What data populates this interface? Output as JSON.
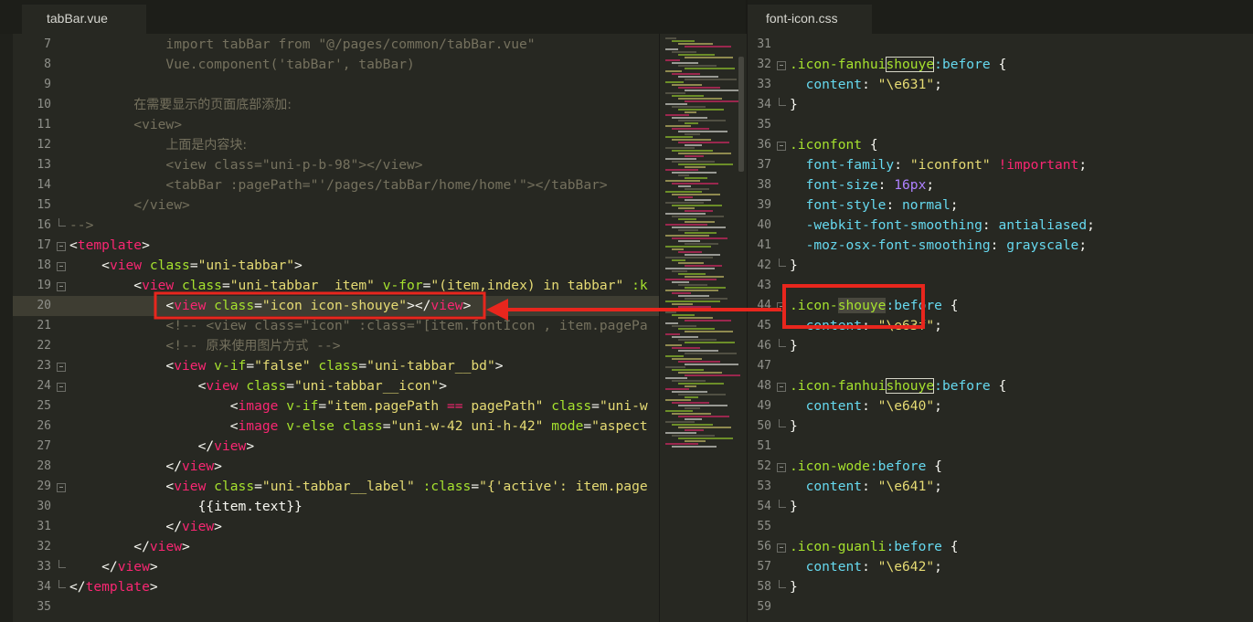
{
  "tabs": {
    "left": "tabBar.vue",
    "right": "font-icon.css"
  },
  "colors": {
    "background": "#272822",
    "annotation": "#e8261d",
    "tag": "#f92672",
    "attribute": "#a6e22e",
    "string": "#e6db74",
    "comment": "#75715e"
  },
  "left_editor": {
    "lines": [
      {
        "num": "7",
        "tokens": [
          [
            "cmt",
            "            import tabBar from \"@/pages/common/tabBar.vue\""
          ]
        ]
      },
      {
        "num": "8",
        "tokens": [
          [
            "cmt",
            "            Vue.component('tabBar', tabBar)"
          ]
        ]
      },
      {
        "num": "9",
        "tokens": [
          [
            "cmt",
            ""
          ]
        ]
      },
      {
        "num": "10",
        "tokens": [
          [
            "cmt",
            "        "
          ],
          [
            "cmt cn",
            "在需要显示的页面底部添加:"
          ]
        ]
      },
      {
        "num": "11",
        "tokens": [
          [
            "cmt",
            "        <view>"
          ]
        ]
      },
      {
        "num": "12",
        "tokens": [
          [
            "cmt",
            "            "
          ],
          [
            "cmt cn",
            "上面是内容块:"
          ]
        ]
      },
      {
        "num": "13",
        "tokens": [
          [
            "cmt",
            "            <view class=\"uni-p-b-98\"></view>"
          ]
        ]
      },
      {
        "num": "14",
        "tokens": [
          [
            "cmt",
            "            <tabBar :pagePath=\"'/pages/tabBar/home/home'\"></tabBar>"
          ]
        ]
      },
      {
        "num": "15",
        "tokens": [
          [
            "cmt",
            "        </view>"
          ]
        ]
      },
      {
        "num": "16",
        "tokens": [
          [
            "cmt",
            "-->"
          ]
        ]
      },
      {
        "num": "17",
        "tokens": [
          [
            "pln",
            "<"
          ],
          [
            "tag",
            "template"
          ],
          [
            "pln",
            ">"
          ]
        ]
      },
      {
        "num": "18",
        "tokens": [
          [
            "pln",
            "    <"
          ],
          [
            "tag",
            "view"
          ],
          [
            "att",
            " class"
          ],
          [
            "pln",
            "="
          ],
          [
            "str",
            "\"uni-tabbar\""
          ],
          [
            "pln",
            ">"
          ]
        ]
      },
      {
        "num": "19",
        "tokens": [
          [
            "pln",
            "        <"
          ],
          [
            "tag",
            "view"
          ],
          [
            "att",
            " class"
          ],
          [
            "pln",
            "="
          ],
          [
            "str",
            "\"uni-tabbar__item\""
          ],
          [
            "att",
            " v-for"
          ],
          [
            "pln",
            "="
          ],
          [
            "str",
            "\"(item,index) in tabbar\""
          ],
          [
            "att",
            " :k"
          ]
        ]
      },
      {
        "num": "20",
        "tokens": [
          [
            "pln",
            "            <"
          ],
          [
            "tag",
            "view"
          ],
          [
            "att",
            " class"
          ],
          [
            "pln",
            "="
          ],
          [
            "str",
            "\"icon icon-shouye\""
          ],
          [
            "pln",
            "></"
          ],
          [
            "tag",
            "view"
          ],
          [
            "pln",
            ">"
          ]
        ]
      },
      {
        "num": "21",
        "tokens": [
          [
            "cmt",
            "            <!-- <view class=\"icon\" :class=\"[item.fontIcon , item.pagePa"
          ]
        ]
      },
      {
        "num": "22",
        "tokens": [
          [
            "cmt",
            "            <!-- "
          ],
          [
            "cmt cn",
            "原来使用图片方式"
          ],
          [
            "cmt",
            " -->"
          ]
        ]
      },
      {
        "num": "23",
        "tokens": [
          [
            "pln",
            "            <"
          ],
          [
            "tag",
            "view"
          ],
          [
            "att",
            " v-if"
          ],
          [
            "pln",
            "="
          ],
          [
            "str",
            "\"false\""
          ],
          [
            "att",
            " class"
          ],
          [
            "pln",
            "="
          ],
          [
            "str",
            "\"uni-tabbar__bd\""
          ],
          [
            "pln",
            ">"
          ]
        ]
      },
      {
        "num": "24",
        "tokens": [
          [
            "pln",
            "                <"
          ],
          [
            "tag",
            "view"
          ],
          [
            "att",
            " class"
          ],
          [
            "pln",
            "="
          ],
          [
            "str",
            "\"uni-tabbar__icon\""
          ],
          [
            "pln",
            ">"
          ]
        ]
      },
      {
        "num": "25",
        "tokens": [
          [
            "pln",
            "                    <"
          ],
          [
            "tag",
            "image"
          ],
          [
            "att",
            " v-if"
          ],
          [
            "pln",
            "="
          ],
          [
            "str",
            "\"item.pagePath "
          ],
          [
            "tag",
            "=="
          ],
          [
            "str",
            " pagePath\""
          ],
          [
            "att",
            " class"
          ],
          [
            "pln",
            "="
          ],
          [
            "str",
            "\"uni-w"
          ]
        ]
      },
      {
        "num": "26",
        "tokens": [
          [
            "pln",
            "                    <"
          ],
          [
            "tag",
            "image"
          ],
          [
            "att",
            " v-else"
          ],
          [
            "att",
            " class"
          ],
          [
            "pln",
            "="
          ],
          [
            "str",
            "\"uni-w-42 uni-h-42\""
          ],
          [
            "att",
            " mode"
          ],
          [
            "pln",
            "="
          ],
          [
            "str",
            "\"aspect"
          ]
        ]
      },
      {
        "num": "27",
        "tokens": [
          [
            "pln",
            "                </"
          ],
          [
            "tag",
            "view"
          ],
          [
            "pln",
            ">"
          ]
        ]
      },
      {
        "num": "28",
        "tokens": [
          [
            "pln",
            "            </"
          ],
          [
            "tag",
            "view"
          ],
          [
            "pln",
            ">"
          ]
        ]
      },
      {
        "num": "29",
        "tokens": [
          [
            "pln",
            "            <"
          ],
          [
            "tag",
            "view"
          ],
          [
            "att",
            " class"
          ],
          [
            "pln",
            "="
          ],
          [
            "str",
            "\"uni-tabbar__label\""
          ],
          [
            "att",
            " :class"
          ],
          [
            "pln",
            "="
          ],
          [
            "str",
            "\"{'active': item.page"
          ]
        ]
      },
      {
        "num": "30",
        "tokens": [
          [
            "pln",
            "                {{item.text}}"
          ]
        ]
      },
      {
        "num": "31",
        "tokens": [
          [
            "pln",
            "            </"
          ],
          [
            "tag",
            "view"
          ],
          [
            "pln",
            ">"
          ]
        ]
      },
      {
        "num": "32",
        "tokens": [
          [
            "pln",
            "        </"
          ],
          [
            "tag",
            "view"
          ],
          [
            "pln",
            ">"
          ]
        ]
      },
      {
        "num": "33",
        "tokens": [
          [
            "pln",
            "    </"
          ],
          [
            "tag",
            "view"
          ],
          [
            "pln",
            ">"
          ]
        ]
      },
      {
        "num": "34",
        "tokens": [
          [
            "pln",
            "</"
          ],
          [
            "tag",
            "template"
          ],
          [
            "pln",
            ">"
          ]
        ]
      },
      {
        "num": "35",
        "tokens": [
          [
            "pln",
            ""
          ]
        ]
      }
    ]
  },
  "right_editor": {
    "lines": [
      {
        "num": "31",
        "tokens": [
          [
            "pln",
            ""
          ]
        ]
      },
      {
        "num": "32",
        "tokens": [
          [
            "cls",
            ".icon-fanhui"
          ],
          [
            "cls match",
            "shouye"
          ],
          [
            "prop",
            ":before"
          ],
          [
            "pln",
            " {"
          ]
        ]
      },
      {
        "num": "33",
        "tokens": [
          [
            "prop",
            "  content"
          ],
          [
            "pln",
            ": "
          ],
          [
            "str",
            "\"\\e631\""
          ],
          [
            "pln",
            ";"
          ]
        ]
      },
      {
        "num": "34",
        "tokens": [
          [
            "pln",
            "}"
          ]
        ]
      },
      {
        "num": "35",
        "tokens": [
          [
            "pln",
            ""
          ]
        ]
      },
      {
        "num": "36",
        "tokens": [
          [
            "cls",
            ".iconfont"
          ],
          [
            "pln",
            " {"
          ]
        ]
      },
      {
        "num": "37",
        "tokens": [
          [
            "prop",
            "  font-family"
          ],
          [
            "pln",
            ": "
          ],
          [
            "str",
            "\"iconfont\""
          ],
          [
            "tag",
            " !important"
          ],
          [
            "pln",
            ";"
          ]
        ]
      },
      {
        "num": "38",
        "tokens": [
          [
            "prop",
            "  font-size"
          ],
          [
            "pln",
            ": "
          ],
          [
            "num",
            "16px"
          ],
          [
            "pln",
            ";"
          ]
        ]
      },
      {
        "num": "39",
        "tokens": [
          [
            "prop",
            "  font-style"
          ],
          [
            "pln",
            ": "
          ],
          [
            "prop",
            "normal"
          ],
          [
            "pln",
            ";"
          ]
        ]
      },
      {
        "num": "40",
        "tokens": [
          [
            "prop",
            "  -webkit-font-smoothing"
          ],
          [
            "pln",
            ": "
          ],
          [
            "prop",
            "antialiased"
          ],
          [
            "pln",
            ";"
          ]
        ]
      },
      {
        "num": "41",
        "tokens": [
          [
            "prop",
            "  -moz-osx-font-smoothing"
          ],
          [
            "pln",
            ": "
          ],
          [
            "prop",
            "grayscale"
          ],
          [
            "pln",
            ";"
          ]
        ]
      },
      {
        "num": "42",
        "tokens": [
          [
            "pln",
            "}"
          ]
        ]
      },
      {
        "num": "43",
        "tokens": [
          [
            "pln",
            ""
          ]
        ]
      },
      {
        "num": "44",
        "tokens": [
          [
            "cls",
            ".icon-"
          ],
          [
            "cls sel",
            "shouye"
          ],
          [
            "prop",
            ":before"
          ],
          [
            "pln",
            " {"
          ]
        ]
      },
      {
        "num": "45",
        "tokens": [
          [
            "prop",
            "  content"
          ],
          [
            "pln",
            ": "
          ],
          [
            "str",
            "\"\\e63f\""
          ],
          [
            "pln",
            ";"
          ]
        ]
      },
      {
        "num": "46",
        "tokens": [
          [
            "pln",
            "}"
          ]
        ]
      },
      {
        "num": "47",
        "tokens": [
          [
            "pln",
            ""
          ]
        ]
      },
      {
        "num": "48",
        "tokens": [
          [
            "cls",
            ".icon-fanhui"
          ],
          [
            "cls match",
            "shouye"
          ],
          [
            "prop",
            ":before"
          ],
          [
            "pln",
            " {"
          ]
        ]
      },
      {
        "num": "49",
        "tokens": [
          [
            "prop",
            "  content"
          ],
          [
            "pln",
            ": "
          ],
          [
            "str",
            "\"\\e640\""
          ],
          [
            "pln",
            ";"
          ]
        ]
      },
      {
        "num": "50",
        "tokens": [
          [
            "pln",
            "}"
          ]
        ]
      },
      {
        "num": "51",
        "tokens": [
          [
            "pln",
            ""
          ]
        ]
      },
      {
        "num": "52",
        "tokens": [
          [
            "cls",
            ".icon-wode"
          ],
          [
            "prop",
            ":before"
          ],
          [
            "pln",
            " {"
          ]
        ]
      },
      {
        "num": "53",
        "tokens": [
          [
            "prop",
            "  content"
          ],
          [
            "pln",
            ": "
          ],
          [
            "str",
            "\"\\e641\""
          ],
          [
            "pln",
            ";"
          ]
        ]
      },
      {
        "num": "54",
        "tokens": [
          [
            "pln",
            "}"
          ]
        ]
      },
      {
        "num": "55",
        "tokens": [
          [
            "pln",
            ""
          ]
        ]
      },
      {
        "num": "56",
        "tokens": [
          [
            "cls",
            ".icon-guanli"
          ],
          [
            "prop",
            ":before"
          ],
          [
            "pln",
            " {"
          ]
        ]
      },
      {
        "num": "57",
        "tokens": [
          [
            "prop",
            "  content"
          ],
          [
            "pln",
            ": "
          ],
          [
            "str",
            "\"\\e642\""
          ],
          [
            "pln",
            ";"
          ]
        ]
      },
      {
        "num": "58",
        "tokens": [
          [
            "pln",
            "}"
          ]
        ]
      },
      {
        "num": "59",
        "tokens": [
          [
            "pln",
            ""
          ]
        ]
      }
    ]
  }
}
